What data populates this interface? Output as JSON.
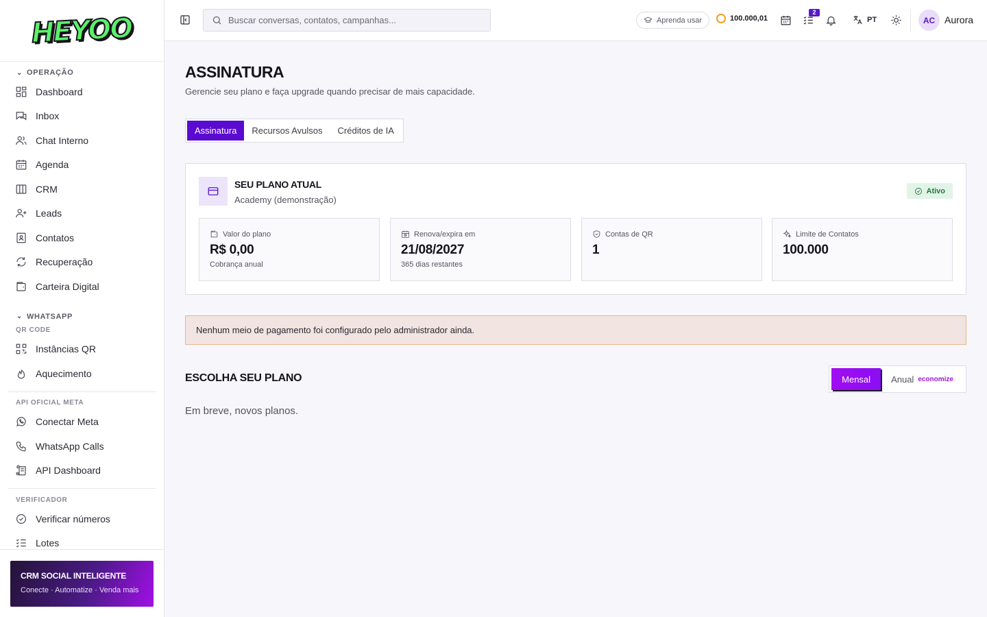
{
  "brand": {
    "logo_text": "HEYOO"
  },
  "sidebar": {
    "sections": [
      {
        "title": "OPERAÇÃO",
        "items": [
          {
            "label": "Dashboard",
            "icon": "dashboard-icon"
          },
          {
            "label": "Inbox",
            "icon": "inbox-icon"
          },
          {
            "label": "Chat Interno",
            "icon": "users-icon"
          },
          {
            "label": "Agenda",
            "icon": "calendar-icon"
          },
          {
            "label": "CRM",
            "icon": "columns-icon"
          },
          {
            "label": "Leads",
            "icon": "user-plus-icon"
          },
          {
            "label": "Contatos",
            "icon": "contact-book-icon"
          },
          {
            "label": "Recuperação",
            "icon": "refresh-icon"
          },
          {
            "label": "Carteira Digital",
            "icon": "wallet-icon"
          }
        ]
      },
      {
        "title": "WHATSAPP",
        "subsections": [
          {
            "title": "QR CODE",
            "items": [
              {
                "label": "Instâncias QR",
                "icon": "qr-code-icon"
              },
              {
                "label": "Aquecimento",
                "icon": "flame-icon"
              }
            ]
          },
          {
            "title": "API OFICIAL META",
            "items": [
              {
                "label": "Conectar Meta",
                "icon": "whatsapp-icon"
              },
              {
                "label": "WhatsApp Calls",
                "icon": "phone-icon"
              },
              {
                "label": "API Dashboard",
                "icon": "scroll-icon"
              }
            ]
          },
          {
            "title": "VERIFICADOR",
            "items": [
              {
                "label": "Verificar números",
                "icon": "check-circle-icon"
              },
              {
                "label": "Lotes",
                "icon": "list-check-icon"
              }
            ]
          }
        ]
      }
    ],
    "promo": {
      "title": "CRM SOCIAL INTELIGENTE",
      "subtitle": "Conecte · Automatize · Venda mais"
    }
  },
  "topbar": {
    "search_placeholder": "Buscar conversas, contatos, campanhas...",
    "learn_label": "Aprenda usar",
    "credits": "100.000,01",
    "tasks_badge": "2",
    "language": "PT",
    "user": {
      "initials": "AC",
      "name": "Aurora"
    }
  },
  "page": {
    "title": "ASSINATURA",
    "subtitle": "Gerencie seu plano e faça upgrade quando precisar de mais capacidade.",
    "tabs": [
      {
        "label": "Assinatura",
        "active": true
      },
      {
        "label": "Recursos Avulsos",
        "active": false
      },
      {
        "label": "Créditos de IA",
        "active": false
      }
    ]
  },
  "plan": {
    "heading": "SEU PLANO ATUAL",
    "name": "Academy (demonstração)",
    "status": "Ativo",
    "stats": [
      {
        "label": "Valor do plano",
        "value": "R$ 0,00",
        "note": "Cobrança anual",
        "icon": "wallet-icon"
      },
      {
        "label": "Renova/expira em",
        "value": "21/08/2027",
        "note": "365 dias restantes",
        "icon": "calendar-clock-icon"
      },
      {
        "label": "Contas de QR",
        "value": "1",
        "note": "",
        "icon": "shield-icon"
      },
      {
        "label": "Limite de Contatos",
        "value": "100.000",
        "note": "",
        "icon": "sparkles-icon"
      }
    ]
  },
  "alert": {
    "text": "Nenhum meio de pagamento foi configurado pelo administrador ainda."
  },
  "choose": {
    "title": "ESCOLHA SEU PLANO",
    "billing": {
      "monthly": "Mensal",
      "annual": "Anual",
      "annual_badge": "economize",
      "selected": "monthly"
    },
    "empty_text": "Em breve, novos planos."
  },
  "colors": {
    "accent": "#5b0ad0",
    "accent_alt": "#a20cf2",
    "status_ok": "#1f7a3a",
    "logo_green": "#5cf06a"
  }
}
